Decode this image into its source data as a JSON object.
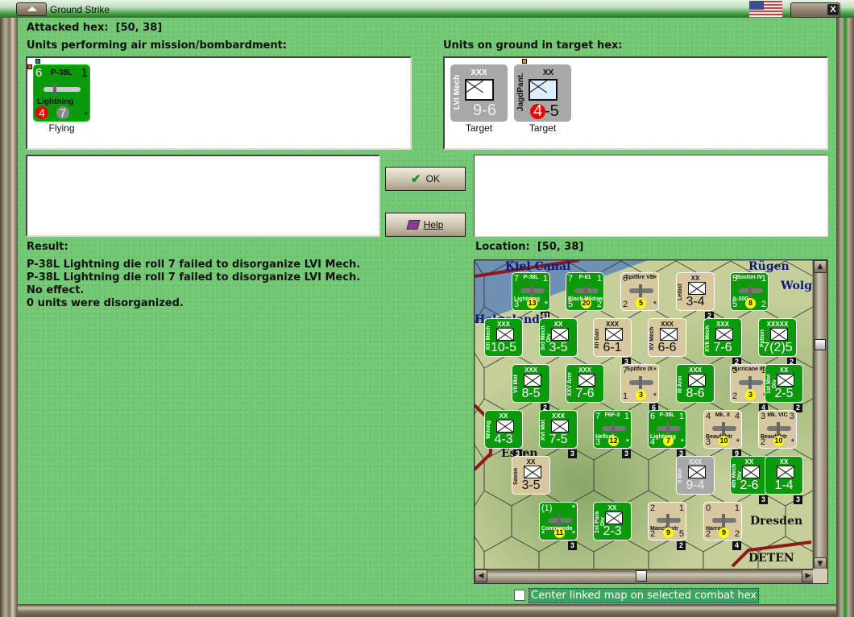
{
  "window": {
    "title": "Ground Strike",
    "close_label": "X"
  },
  "attacked_hex": {
    "label": "Attacked hex:",
    "value": "[50, 38]"
  },
  "air_units": {
    "heading": "Units performing air mission/bombardment:",
    "items": [
      {
        "tl": "6",
        "name": "P-38L",
        "tr": "1",
        "sub": "Lightning",
        "red_badge": "4",
        "gray_badge": "7",
        "star": "*",
        "status": "Flying"
      }
    ]
  },
  "ground_units": {
    "heading": "Units on ground in target hex:",
    "items": [
      {
        "size": "XXX",
        "label": "LVI Mech",
        "value": "9-6",
        "status": "Target"
      },
      {
        "size": "XX",
        "label": "JagdPant.",
        "value_a": "4",
        "value_b": "-5",
        "status": "Target"
      }
    ]
  },
  "buttons": {
    "ok": "OK",
    "help": "Help"
  },
  "result": {
    "heading": "Result:",
    "lines": [
      "P-38L Lightning die roll 7 failed to disorganize LVI Mech.",
      "P-38L Lightning die roll 7 failed to disorganize LVI Mech.",
      "No effect.",
      "0 units were disorganized."
    ]
  },
  "location": {
    "label": "Location:",
    "value": "[50, 38]"
  },
  "map": {
    "place_names": [
      "Kiel Canal",
      "Rügen",
      "Wolg",
      "Helgoland",
      "Essen",
      "Dresden",
      "DETEN"
    ],
    "counters": [
      {
        "kind": "air",
        "c": "g",
        "tl": "7",
        "name": "P-38L",
        "tr": "1",
        "sub": "Lightning",
        "bl": "3",
        "br": "*",
        "badge": "13",
        "stack": "41"
      },
      {
        "kind": "air",
        "c": "g",
        "tl": "7",
        "name": "P-61",
        "tr": "1",
        "sub": "Black Widow",
        "bl": "5",
        "br": "2",
        "badge": "20"
      },
      {
        "kind": "air",
        "c": "t",
        "tl": "6",
        "name": "Spitfire VB",
        "tr": "*",
        "sub": "",
        "bl": "2",
        "br": "*",
        "badge": "5"
      },
      {
        "kind": "unit",
        "c": "t",
        "size": "XX",
        "label": "Leibst",
        "value": "3-4",
        "stack": "2"
      },
      {
        "kind": "air",
        "c": "g",
        "tl": "5",
        "name": "Boston IV",
        "tr": "1",
        "sub": "A-20G",
        "bl": "5",
        "br": "2",
        "badge": "8"
      },
      {
        "kind": "unit",
        "c": "g",
        "size": "XXX",
        "label": "XIII Mech",
        "value": "10-5"
      },
      {
        "kind": "unit",
        "c": "g",
        "size": "XX",
        "label": "3rd Mech Div",
        "value": "3-5"
      },
      {
        "kind": "unit",
        "c": "t",
        "size": "XXX",
        "label": "XII Garr",
        "value": "6-1",
        "stack": "3"
      },
      {
        "kind": "unit",
        "c": "t",
        "size": "XXX",
        "label": "XV Mech",
        "value": "6-6"
      },
      {
        "kind": "unit",
        "c": "g",
        "size": "XXX",
        "label": "XVII Mech",
        "value": "7-6",
        "stack": "2"
      },
      {
        "kind": "unit",
        "c": "g",
        "size": "XXXXX",
        "label": "Patton",
        "value": "7(2)5",
        "stack": "2"
      },
      {
        "kind": "unit",
        "c": "g",
        "size": "XXX",
        "label": "VII Mot",
        "value": "8-5",
        "stack": "2"
      },
      {
        "kind": "unit",
        "c": "g",
        "size": "XXX",
        "label": "XXV Arm",
        "value": "7-6"
      },
      {
        "kind": "air",
        "c": "t",
        "tl": "7",
        "name": "Spitfire IX",
        "tr": "*",
        "sub": "",
        "bl": "1",
        "br": "*",
        "badge": "3",
        "stack": "6"
      },
      {
        "kind": "unit",
        "c": "g",
        "size": "XXX",
        "label": "III Arm",
        "value": "8-6"
      },
      {
        "kind": "air",
        "c": "t",
        "tl": "3",
        "name": "Hurricane IID",
        "tr": "1",
        "sub": "",
        "bl": "2",
        "br": "*",
        "badge": "3",
        "stack": "4"
      },
      {
        "kind": "unit",
        "c": "g",
        "size": "XX",
        "label": "1st Mot Div",
        "value": "2-5",
        "stack": "2"
      },
      {
        "kind": "unit",
        "c": "g",
        "size": "XX",
        "label": "Wiking",
        "value": "4-3",
        "stack": "3"
      },
      {
        "kind": "unit",
        "c": "g",
        "size": "XXX",
        "label": "XVI Mot",
        "value": "7-5",
        "stack": "3"
      },
      {
        "kind": "air",
        "c": "g",
        "tl": "7",
        "name": "F6F-3",
        "tr": "1",
        "sub": "Hellcat",
        "bl": "3",
        "br": "*",
        "badge": "12",
        "stack": "3"
      },
      {
        "kind": "air",
        "c": "g",
        "tl": "6",
        "name": "P-38L",
        "tr": "1",
        "sub": "Lightning",
        "bl": "4",
        "br": "*",
        "badge": "7",
        "stack": "3"
      },
      {
        "kind": "air",
        "c": "t",
        "tl": "4",
        "name": "Mk. X",
        "tr": "4",
        "sub": "Beaufghtr",
        "bl": "3",
        "br": "*",
        "badge": "10",
        "stack": "9"
      },
      {
        "kind": "air",
        "c": "t",
        "tl": "3",
        "name": "Mk. VIC",
        "tr": "3",
        "sub": "Beaufghtr",
        "bl": "2",
        "br": "*",
        "badge": "10"
      },
      {
        "kind": "unit",
        "c": "t",
        "size": "XX",
        "label": "Saxon",
        "value": "3-5"
      },
      {
        "kind": "unit",
        "c": "gr",
        "size": "XXX",
        "label": "II Mot",
        "value": "9-4"
      },
      {
        "kind": "unit",
        "c": "g",
        "size": "XX",
        "label": "4th Mech Div",
        "value": "2-6",
        "stack": "3"
      },
      {
        "kind": "unit",
        "c": "g",
        "size": "XX",
        "label": "",
        "value": "1-4",
        "stack": "3"
      },
      {
        "kind": "air",
        "c": "g",
        "tl": "(1)",
        "name": "",
        "tr": "*",
        "sub": "Commando",
        "bl": "*",
        "br": "*",
        "badge": "11",
        "stack": "3"
      },
      {
        "kind": "unit",
        "c": "g",
        "size": "XX",
        "label": "1st Para Div",
        "value": "2-3"
      },
      {
        "kind": "air",
        "c": "t",
        "tl": "2",
        "name": "",
        "tr": "1",
        "sub": "Manchestr",
        "bl": "2",
        "br": "5",
        "badge": "9",
        "stack": "2"
      },
      {
        "kind": "air",
        "c": "t",
        "tl": "0",
        "name": "",
        "tr": "1",
        "sub": "Harrow",
        "bl": "2",
        "br": "2",
        "badge": "9",
        "stack": "4"
      }
    ]
  },
  "checkbox": {
    "label": "Center linked map on selected combat hex",
    "checked": false
  },
  "colors": {
    "accent_green": "#0a9a0a",
    "tan": "#d8c8a0",
    "red_badge": "#ee0000"
  }
}
